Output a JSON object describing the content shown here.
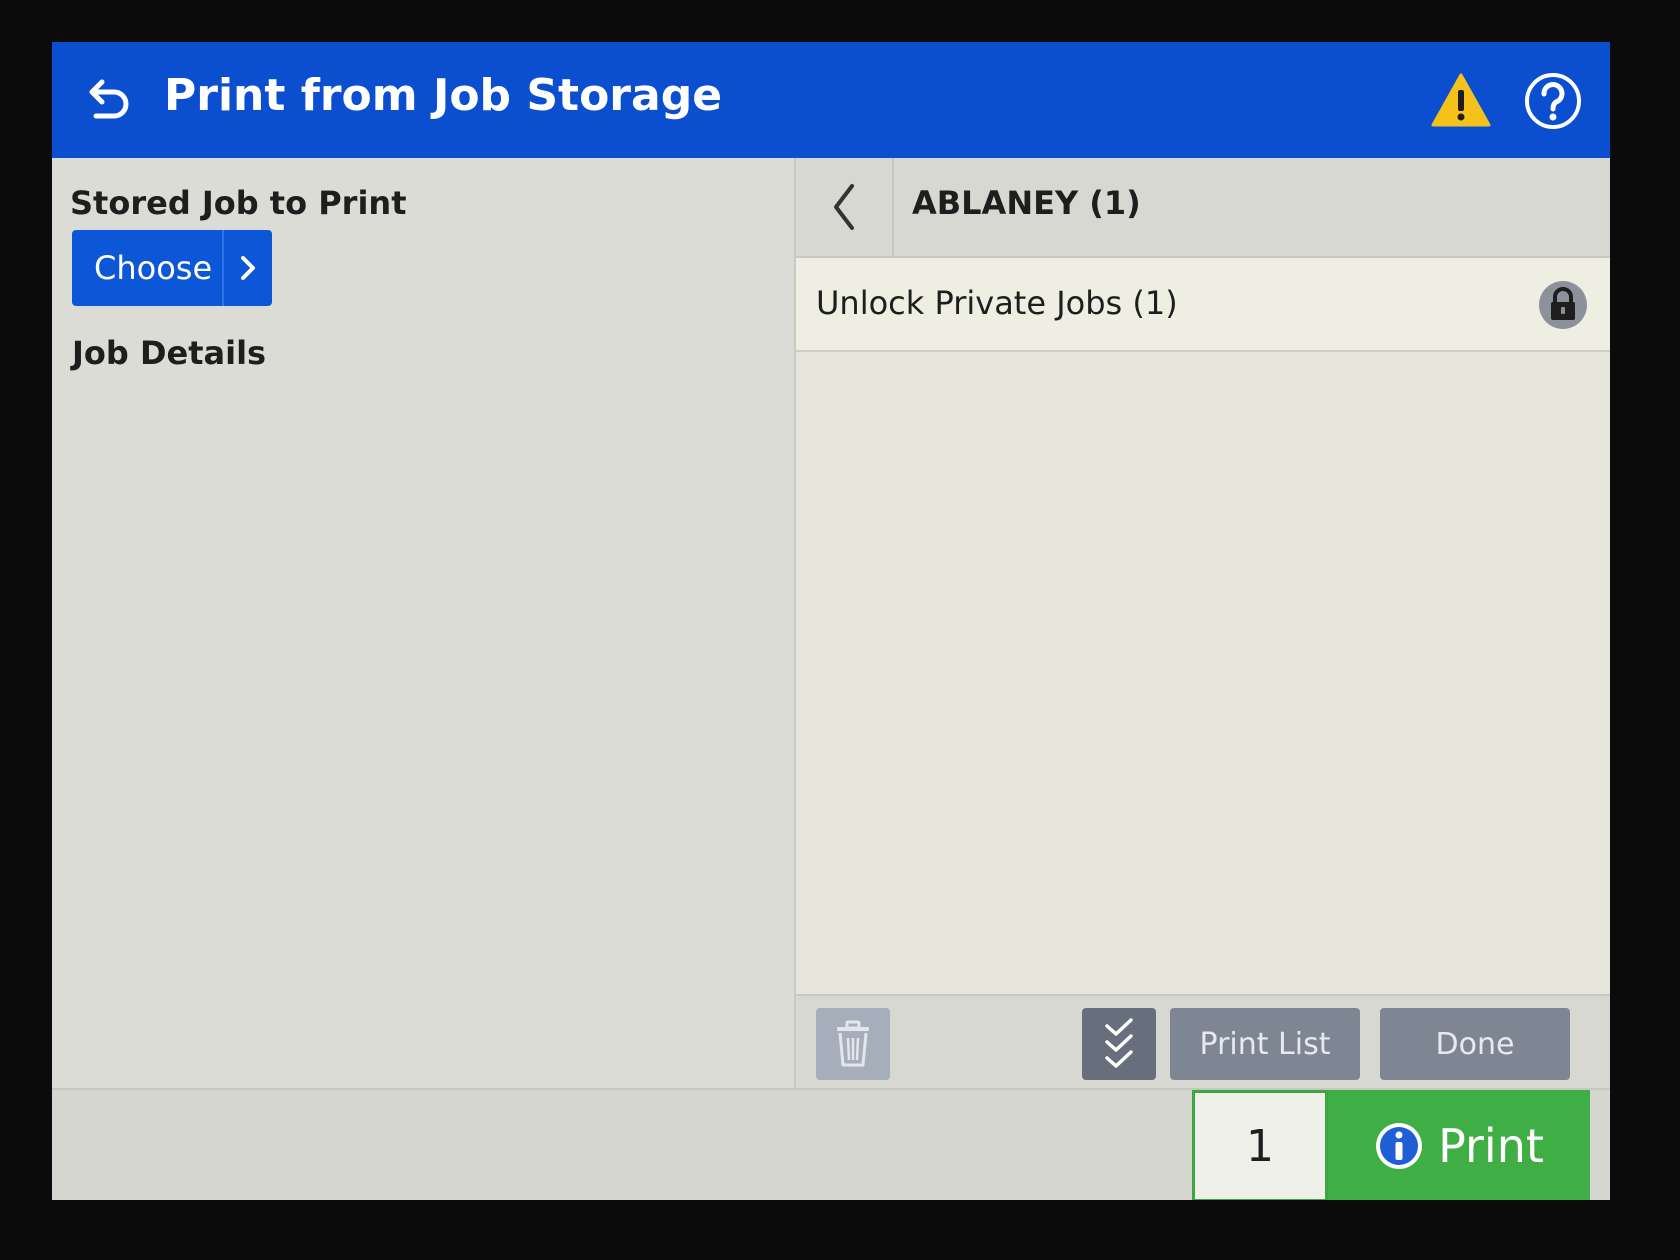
{
  "header": {
    "title": "Print from Job Storage",
    "color": "#0b4fd0",
    "icons": [
      "back-arrow-icon",
      "warning-icon",
      "help-icon"
    ]
  },
  "left_panel": {
    "stored_job_label": "Stored Job to Print",
    "choose_label": "Choose",
    "job_details_label": "Job Details"
  },
  "right_panel": {
    "folder_title": "ABLANEY (1)",
    "unlock_label": "Unlock Private Jobs (1)",
    "print_list_label": "Print List",
    "done_label": "Done"
  },
  "bottom": {
    "copies_value": "1",
    "print_label": "Print",
    "print_color": "#3fae45"
  }
}
